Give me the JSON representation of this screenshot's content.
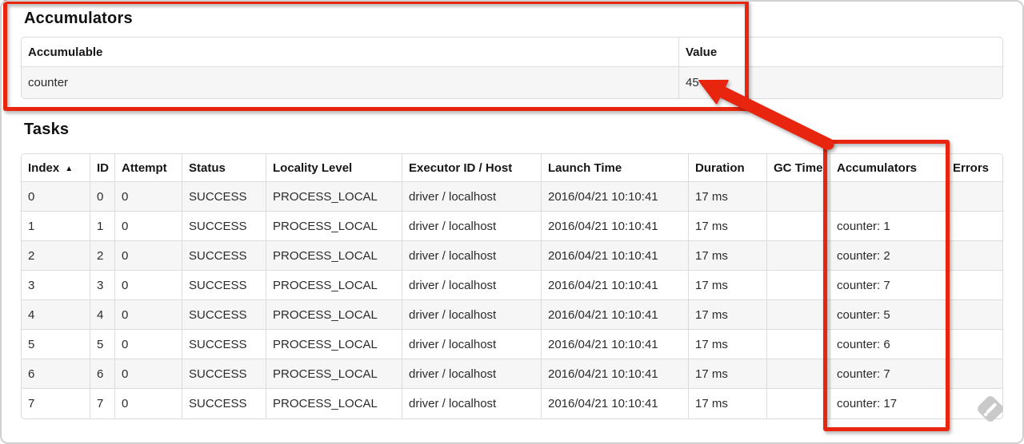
{
  "annotation": {
    "color": "#e8250f",
    "shapes": [
      "box-around-accumulators-section",
      "box-around-accumulators-column",
      "arrow-to-value-45"
    ]
  },
  "accumulators_section": {
    "heading": "Accumulators",
    "table": {
      "headers": {
        "accumulable": "Accumulable",
        "value": "Value"
      },
      "rows": [
        {
          "accumulable": "counter",
          "value": "45"
        }
      ]
    }
  },
  "tasks_section": {
    "heading": "Tasks",
    "table": {
      "headers": {
        "index": "Index",
        "id": "ID",
        "attempt": "Attempt",
        "status": "Status",
        "locality_level": "Locality Level",
        "executor_id_host": "Executor ID / Host",
        "launch_time": "Launch Time",
        "duration": "Duration",
        "gc_time": "GC Time",
        "accumulators": "Accumulators",
        "errors": "Errors"
      },
      "sort_icon": "▲",
      "rows": [
        {
          "index": "0",
          "id": "0",
          "attempt": "0",
          "status": "SUCCESS",
          "locality_level": "PROCESS_LOCAL",
          "executor_id_host": "driver / localhost",
          "launch_time": "2016/04/21 10:10:41",
          "duration": "17 ms",
          "gc_time": "",
          "accumulators": "",
          "errors": ""
        },
        {
          "index": "1",
          "id": "1",
          "attempt": "0",
          "status": "SUCCESS",
          "locality_level": "PROCESS_LOCAL",
          "executor_id_host": "driver / localhost",
          "launch_time": "2016/04/21 10:10:41",
          "duration": "17 ms",
          "gc_time": "",
          "accumulators": "counter: 1",
          "errors": ""
        },
        {
          "index": "2",
          "id": "2",
          "attempt": "0",
          "status": "SUCCESS",
          "locality_level": "PROCESS_LOCAL",
          "executor_id_host": "driver / localhost",
          "launch_time": "2016/04/21 10:10:41",
          "duration": "17 ms",
          "gc_time": "",
          "accumulators": "counter: 2",
          "errors": ""
        },
        {
          "index": "3",
          "id": "3",
          "attempt": "0",
          "status": "SUCCESS",
          "locality_level": "PROCESS_LOCAL",
          "executor_id_host": "driver / localhost",
          "launch_time": "2016/04/21 10:10:41",
          "duration": "17 ms",
          "gc_time": "",
          "accumulators": "counter: 7",
          "errors": ""
        },
        {
          "index": "4",
          "id": "4",
          "attempt": "0",
          "status": "SUCCESS",
          "locality_level": "PROCESS_LOCAL",
          "executor_id_host": "driver / localhost",
          "launch_time": "2016/04/21 10:10:41",
          "duration": "17 ms",
          "gc_time": "",
          "accumulators": "counter: 5",
          "errors": ""
        },
        {
          "index": "5",
          "id": "5",
          "attempt": "0",
          "status": "SUCCESS",
          "locality_level": "PROCESS_LOCAL",
          "executor_id_host": "driver / localhost",
          "launch_time": "2016/04/21 10:10:41",
          "duration": "17 ms",
          "gc_time": "",
          "accumulators": "counter: 6",
          "errors": ""
        },
        {
          "index": "6",
          "id": "6",
          "attempt": "0",
          "status": "SUCCESS",
          "locality_level": "PROCESS_LOCAL",
          "executor_id_host": "driver / localhost",
          "launch_time": "2016/04/21 10:10:41",
          "duration": "17 ms",
          "gc_time": "",
          "accumulators": "counter: 7",
          "errors": ""
        },
        {
          "index": "7",
          "id": "7",
          "attempt": "0",
          "status": "SUCCESS",
          "locality_level": "PROCESS_LOCAL",
          "executor_id_host": "driver / localhost",
          "launch_time": "2016/04/21 10:10:41",
          "duration": "17 ms",
          "gc_time": "",
          "accumulators": "counter: 17",
          "errors": ""
        }
      ]
    }
  },
  "watermark": {
    "icon": "feedly-logo"
  }
}
